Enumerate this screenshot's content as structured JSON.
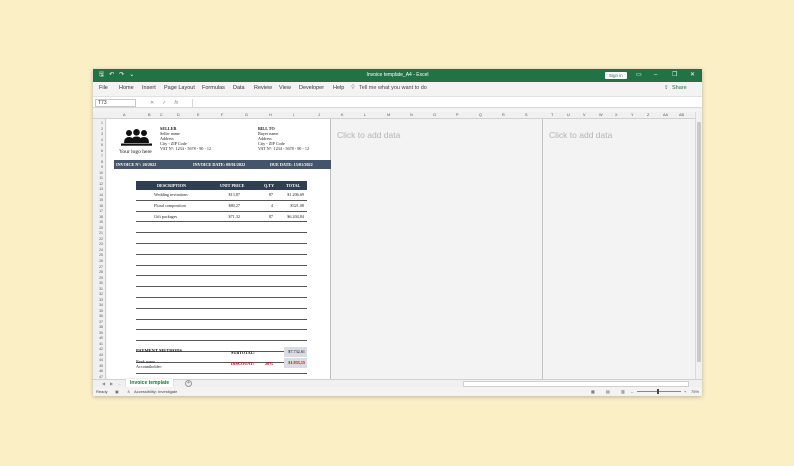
{
  "window": {
    "title": "Invoice template_A4  -  Excel",
    "sign_in": "Sign in",
    "minimize": "–",
    "restore": "❐",
    "close": "✕"
  },
  "ribbon": {
    "tabs": [
      "File",
      "Home",
      "Insert",
      "Page Layout",
      "Formulas",
      "Data",
      "Review",
      "View",
      "Developer",
      "Help"
    ],
    "tell_me": "Tell me what you want to do",
    "share": "Share"
  },
  "formula_bar": {
    "name_box": "T73",
    "formula": ""
  },
  "columns": [
    "A",
    "B",
    "C",
    "D",
    "E",
    "F",
    "G",
    "H",
    "I",
    "J",
    "K",
    "L",
    "M",
    "N",
    "O",
    "P",
    "Q",
    "R",
    "S",
    "T",
    "U",
    "V",
    "W",
    "X",
    "Y",
    "Z",
    "AA",
    "AB"
  ],
  "rows": [
    "1",
    "2",
    "3",
    "4",
    "5",
    "6",
    "7",
    "8",
    "9",
    "10",
    "11",
    "12",
    "13",
    "14",
    "15",
    "16",
    "17",
    "18",
    "19",
    "20",
    "21",
    "22",
    "23",
    "24",
    "25",
    "26",
    "27",
    "28",
    "29",
    "30",
    "31",
    "32",
    "33",
    "34",
    "35",
    "36",
    "37",
    "38",
    "39",
    "40",
    "41",
    "42",
    "43",
    "44",
    "45",
    "46",
    "47"
  ],
  "placeholders": [
    "Click to add data",
    "Click to add data"
  ],
  "invoice": {
    "logo_text": "Your logo here",
    "seller": {
      "heading": "SELLER",
      "lines": [
        "Seller name",
        "Address",
        "City - ZIP Code",
        "VAT N°: 1234 - 5678 - 90 - 12"
      ]
    },
    "bill_to": {
      "heading": "BILL TO",
      "lines": [
        "Buyer name",
        "Address",
        "City - ZIP Code",
        "VAT N°: 1234 - 5678 - 90 - 12"
      ]
    },
    "info": {
      "number": "INVOICE N°: 20/2022",
      "date": "INVOICE DATE: 08/01/2022",
      "due": "DUE DATE: 15/01/2022"
    },
    "table": {
      "headers": [
        "DESCRIPTION",
        "UNIT PRICE",
        "Q.TY",
        "TOTAL"
      ],
      "rows": [
        {
          "description": "Wedding invitations",
          "unit_price": "$13,87",
          "qty": "87",
          "total": "$1.206,69"
        },
        {
          "description": "Floral composition",
          "unit_price": "$80,27",
          "qty": "4",
          "total": "$321,08"
        },
        {
          "description": "Gift packages",
          "unit_price": "$71,32",
          "qty": "87",
          "total": "$6.204,84"
        },
        {
          "description": "",
          "unit_price": "",
          "qty": "",
          "total": ""
        },
        {
          "description": "",
          "unit_price": "",
          "qty": "",
          "total": ""
        },
        {
          "description": "",
          "unit_price": "",
          "qty": "",
          "total": ""
        },
        {
          "description": "",
          "unit_price": "",
          "qty": "",
          "total": ""
        },
        {
          "description": "",
          "unit_price": "",
          "qty": "",
          "total": ""
        },
        {
          "description": "",
          "unit_price": "",
          "qty": "",
          "total": ""
        },
        {
          "description": "",
          "unit_price": "",
          "qty": "",
          "total": ""
        },
        {
          "description": "",
          "unit_price": "",
          "qty": "",
          "total": ""
        },
        {
          "description": "",
          "unit_price": "",
          "qty": "",
          "total": ""
        },
        {
          "description": "",
          "unit_price": "",
          "qty": "",
          "total": ""
        },
        {
          "description": "",
          "unit_price": "",
          "qty": "",
          "total": ""
        },
        {
          "description": "",
          "unit_price": "",
          "qty": "",
          "total": ""
        },
        {
          "description": "",
          "unit_price": "",
          "qty": "",
          "total": ""
        },
        {
          "description": "",
          "unit_price": "",
          "qty": "",
          "total": ""
        },
        {
          "description": "",
          "unit_price": "",
          "qty": "",
          "total": ""
        }
      ]
    },
    "payment_methods": "PAYMENT METHODS",
    "bank_lines": [
      "Bank name",
      "Accountholder:"
    ],
    "subtotal_label": "SUBTOTAL:",
    "subtotal_value": "$7.732,61",
    "discount_label": "DISCOUNT:",
    "discount_pct": "20%",
    "discount_value": "$1.933,15"
  },
  "sheet_tabs": {
    "prev": "◀",
    "next": "▶",
    "ellipsis": "...",
    "active": "Invoice template",
    "add": "+"
  },
  "status": {
    "ready": "Ready",
    "accessibility": "Accessibility: Investigate",
    "zoom_minus": "–",
    "zoom_plus": "+",
    "zoom": "75%"
  },
  "colors": {
    "excel_green": "#217346",
    "info_bar": "#44546a",
    "table_header": "#2f3e50",
    "discount_red": "#c00000",
    "total_box": "#d9dde3"
  }
}
